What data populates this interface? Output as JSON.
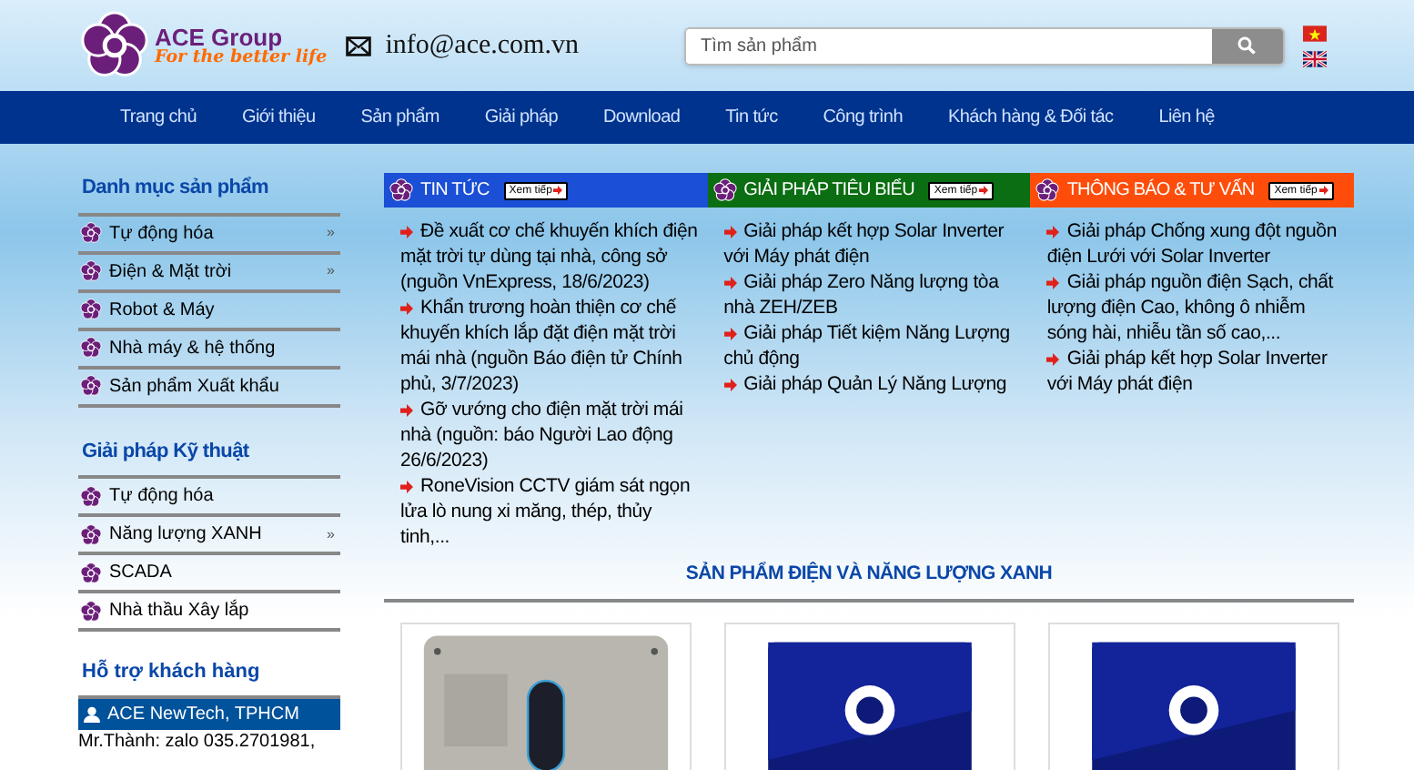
{
  "header": {
    "brand": "ACE Group",
    "slogan": "For the better life",
    "email": "info@ace.com.vn",
    "search": {
      "placeholder": "Tìm sản phẩm"
    },
    "languages": [
      {
        "kind": "vn"
      },
      {
        "kind": "en"
      }
    ]
  },
  "nav": [
    {
      "label": "Trang chủ"
    },
    {
      "label": "Giới thiệu"
    },
    {
      "label": "Sản phẩm"
    },
    {
      "label": "Giải pháp"
    },
    {
      "label": "Download"
    },
    {
      "label": "Tin tức"
    },
    {
      "label": "Công trình"
    },
    {
      "label": "Khách hàng & Đối tác"
    },
    {
      "label": "Liên hệ"
    }
  ],
  "sidebar": {
    "sections": [
      {
        "title": "Danh mục sản phẩm",
        "items": [
          {
            "label": "Tự động hóa",
            "submenu": "»"
          },
          {
            "label": "Điện & Mặt trời",
            "submenu": "»"
          },
          {
            "label": "Robot & Máy"
          },
          {
            "label": "Nhà máy & hệ thống"
          },
          {
            "label": "Sản phẩm Xuất khẩu"
          }
        ]
      },
      {
        "title": "Giải pháp Kỹ thuật",
        "items": [
          {
            "label": "Tự động hóa"
          },
          {
            "label": "Năng lượng XANH",
            "submenu": "»"
          },
          {
            "label": "SCADA"
          },
          {
            "label": "Nhà thầu Xây lắp"
          }
        ]
      }
    ],
    "support": {
      "title": "Hỗ trợ khách hàng",
      "contact_name": "ACE NewTech, TPHCM",
      "contact_line": "Mr.Thành: zalo 035.2701981,"
    }
  },
  "panels": [
    {
      "title": "TIN TỨC",
      "more": "Xem tiếp",
      "color": "#1a4fd6",
      "items": [
        "Đề xuất cơ chế khuyến khích điện mặt trời tự dùng tại nhà, công sở (nguồn VnExpress, 18/6/2023)",
        "Khẩn trương hoàn thiện cơ chế khuyến khích lắp đặt điện mặt trời mái nhà (nguồn Báo điện tử Chính phủ, 3/7/2023)",
        "Gỡ vướng cho điện mặt trời mái nhà (nguồn: báo Người Lao động 26/6/2023)",
        "RoneVision CCTV giám sát ngọn lửa lò nung xi măng, thép, thủy tinh,..."
      ]
    },
    {
      "title": "GIẢI PHÁP TIÊU BIỂU",
      "more": "Xem tiếp",
      "color": "#0b6e12",
      "items": [
        "Giải pháp kết hợp Solar Inverter với Máy phát điện",
        "Giải pháp Zero Năng lượng tòa nhà ZEH/ZEB",
        "Giải pháp Tiết kiệm Năng Lượng chủ động",
        "Giải pháp Quản Lý Năng Lượng"
      ]
    },
    {
      "title": "THÔNG BÁO & TƯ VẤN",
      "more": "Xem tiếp",
      "color": "#fe4d0a",
      "items": [
        "Giải pháp Chống xung đột nguồn điện Lưới với Solar Inverter",
        "Giải pháp nguồn điện Sạch, chất lượng điện Cao, không ô nhiễm sóng hài, nhiễu tần số cao,...",
        "Giải pháp kết hợp Solar Inverter với Máy phát điện"
      ]
    }
  ],
  "products": {
    "title": "SẢN PHẨM ĐIỆN VÀ NĂNG LƯỢNG XANH"
  }
}
